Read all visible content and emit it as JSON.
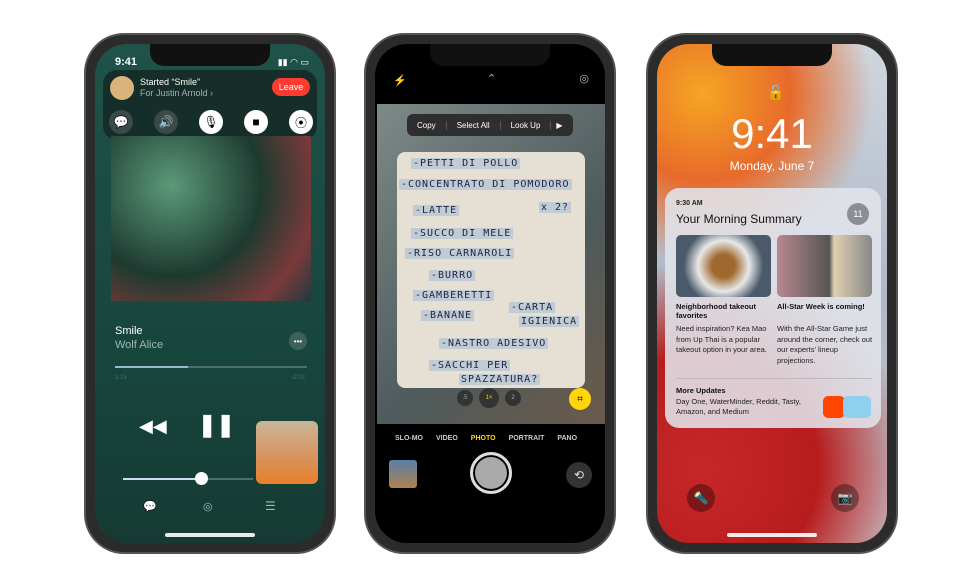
{
  "phone1": {
    "status_time": "9:41",
    "shareplay": {
      "title": "Started “Smile”",
      "subtitle": "For Justin Arnold ›",
      "leave_label": "Leave"
    },
    "controls": [
      "message-icon",
      "speaker-icon",
      "mic-icon",
      "camera-icon",
      "shareplay-icon"
    ],
    "track": {
      "title": "Smile",
      "artist": "Wolf Alice",
      "elapsed": "1:15",
      "remaining": "−2:02",
      "progress": 0.38,
      "volume": 0.6
    },
    "accent": "#1d4f45",
    "leave_color": "#ff3b30"
  },
  "phone2": {
    "menu": [
      "Copy",
      "Select All",
      "Look Up"
    ],
    "note_lines": [
      "-PETTI DI POLLO",
      "-CONCENTRATO DI POMODORO",
      "-LATTE",
      "x 2?",
      "-SUCCO DI MELE",
      "-RISO CARNAROLI",
      "-BURRO",
      "-GAMBERETTI",
      "-BANANE",
      "-CARTA",
      "IGIENICA",
      "-NASTRO ADESIVO",
      "-SACCHI PER",
      "SPAZZATURA?"
    ],
    "zoom_levels": [
      ".5",
      "1×",
      "2"
    ],
    "modes": [
      "SLO-MO",
      "VIDEO",
      "PHOTO",
      "PORTRAIT",
      "PANO"
    ],
    "active_mode": "PHOTO",
    "accent": "#ffd60a"
  },
  "phone3": {
    "time": "9:41",
    "date": "Monday, June 7",
    "summary": {
      "time": "9:30 AM",
      "title": "Your Morning Summary",
      "count": "11",
      "items": [
        {
          "title": "Neighborhood takeout favorites",
          "body": "Need inspiration? Kea Mao from Up Thai is a popular takeout option in your area."
        },
        {
          "title": "All-Star Week is coming!",
          "body": "With the All-Star Game just around the corner, check out our experts' lineup projections."
        }
      ],
      "more_title": "More Updates",
      "more_body": "Day One, WaterMinder, Reddit, Tasty, Amazon, and Medium"
    }
  }
}
